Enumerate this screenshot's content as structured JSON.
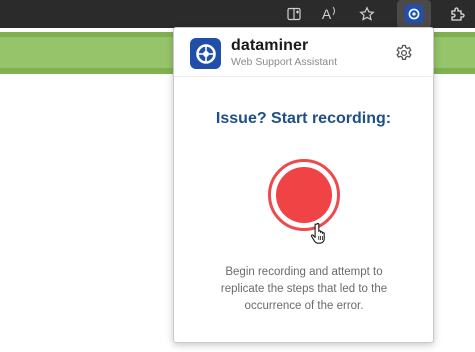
{
  "toolbar": {
    "icons": [
      "split-screen-icon",
      "read-aloud-icon",
      "favorite-star-icon",
      "dataminer-extension-icon",
      "extensions-puzzle-icon"
    ],
    "read_aloud_glyph": "A"
  },
  "colors": {
    "toolbar_bg": "#2b2b2b",
    "page_green": "#7fb24f",
    "brand_blue": "#1f4fa8",
    "headline_blue": "#1e4f86",
    "record_red": "#ef4346"
  },
  "popup": {
    "brand_name": "dataminer",
    "brand_subtitle": "Web Support Assistant",
    "headline": "Issue? Start recording:",
    "description": "Begin recording and attempt to replicate the steps that led to the occurrence of the error."
  }
}
